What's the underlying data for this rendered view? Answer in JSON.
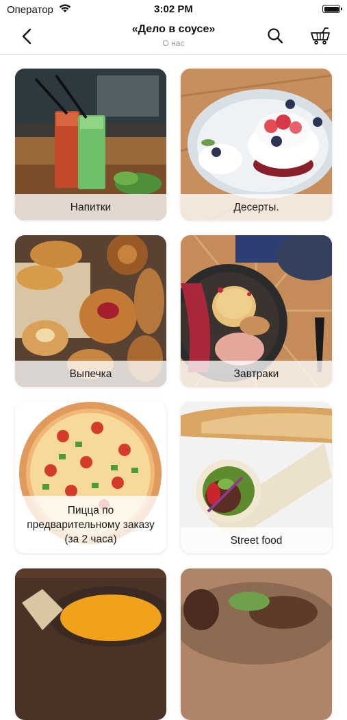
{
  "status_bar": {
    "carrier": "Оператор",
    "time": "3:02 PM"
  },
  "nav": {
    "title": "«Дело в соусе»",
    "subtitle": "О нас"
  },
  "icons": {
    "back": "chevron-left-icon",
    "search": "search-icon",
    "cart": "basket-icon",
    "wifi": "wifi-icon",
    "battery": "battery-icon"
  },
  "categories": [
    {
      "label": "Напитки"
    },
    {
      "label": "Десерты."
    },
    {
      "label": "Выпечка"
    },
    {
      "label": "Завтраки"
    },
    {
      "label": "Пицца по предварительному заказу (за 2 часа)"
    },
    {
      "label": "Street food"
    },
    {
      "label": ""
    },
    {
      "label": ""
    }
  ]
}
